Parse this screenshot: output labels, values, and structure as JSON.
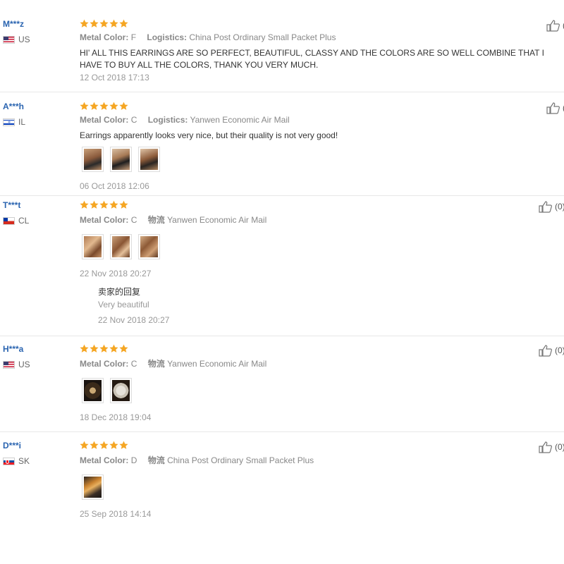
{
  "reviews": [
    {
      "user": "M***z",
      "country": "US",
      "flag": "us",
      "rating": 5,
      "color_label": "Metal Color:",
      "color_value": "F",
      "ship_label": "Logistics:",
      "ship_value": "China Post Ordinary Small Packet Plus",
      "text": "HI' ALL THIS EARRINGS ARE SO PERFECT, BEAUTIFUL, CLASSY AND THE COLORS ARE SO WELL COMBINE THAT I HAVE TO BUY ALL THE COLORS, THANK YOU VERY MUCH.",
      "date": "12 Oct 2018 17:13",
      "likes": "(",
      "photos": 0
    },
    {
      "user": "A***h",
      "country": "IL",
      "flag": "il",
      "rating": 5,
      "color_label": "Metal Color:",
      "color_value": "C",
      "ship_label": "Logistics:",
      "ship_value": "Yanwen Economic Air Mail",
      "text": "Earrings apparently looks very nice, but their quality is not very good!",
      "date": "06 Oct 2018 12:06",
      "likes": "(",
      "photos": 3
    },
    {
      "user": "T***t",
      "country": "CL",
      "flag": "cl",
      "rating": 5,
      "color_label": "Metal Color:",
      "color_value": "C",
      "ship_label": "物流",
      "ship_value": "Yanwen Economic Air Mail",
      "text": "",
      "date": "22 Nov 2018 20:27",
      "likes": "(0)",
      "photos": 3,
      "reply": {
        "title": "卖家的回复",
        "text": "Very beautiful",
        "date": "22 Nov 2018 20:27"
      }
    },
    {
      "user": "H***a",
      "country": "US",
      "flag": "us",
      "rating": 5,
      "color_label": "Metal Color:",
      "color_value": "C",
      "ship_label": "物流",
      "ship_value": "Yanwen Economic Air Mail",
      "text": "",
      "date": "18 Dec 2018 19:04",
      "likes": "(0)",
      "photos": 2
    },
    {
      "user": "D***i",
      "country": "SK",
      "flag": "sk",
      "rating": 5,
      "color_label": "Metal Color:",
      "color_value": "D",
      "ship_label": "物流",
      "ship_value": "China Post Ordinary Small Packet Plus",
      "text": "",
      "date": "25 Sep 2018 14:14",
      "likes": "(0)",
      "photos": 1
    }
  ],
  "colors": {
    "username": "#2a64b0",
    "star": "#f5a623",
    "meta": "#888888",
    "date": "#999999"
  },
  "icons": {
    "star": "star-icon",
    "like": "thumbs-up-icon"
  }
}
